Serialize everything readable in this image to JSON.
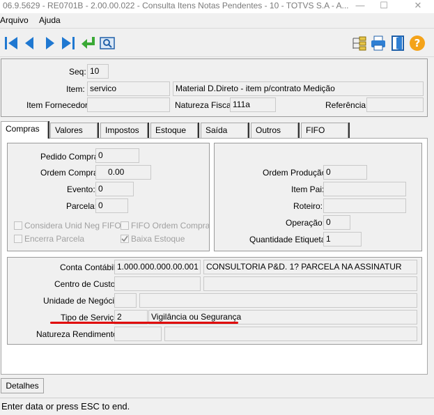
{
  "window": {
    "title": "06.9.5629 - RE0701B - 2.00.00.022 - Consulta Itens Notas Pendentes - 10 - TOTVS S.A - A...",
    "minimize_glyph": "—",
    "maximize_glyph": "☐",
    "close_glyph": "✕"
  },
  "menu": {
    "items": [
      "Arquivo",
      "Ajuda"
    ]
  },
  "toolbar": {
    "left_icons": [
      "first-record-icon",
      "previous-record-icon",
      "next-record-icon",
      "last-record-icon",
      "return-icon",
      "search-icon"
    ],
    "right_icons": [
      "tree-icon",
      "print-icon",
      "exit-icon",
      "help-icon"
    ],
    "colors": {
      "nav_blue": "#1f78d1",
      "return_green": "#3aa935",
      "help_orange": "#f4a31a"
    }
  },
  "header": {
    "seq_label": "Seq:",
    "seq_value": "10",
    "item_label": "Item:",
    "item_value": "servico",
    "item_desc": "Material D.Direto - item p/contrato Medição",
    "item_fornecedor_label": "Item Fornecedor:",
    "item_fornecedor_value": "",
    "natureza_fiscal_label": "Natureza Fiscal",
    "natureza_fiscal_value": "111a",
    "referencia_label": "Referência:",
    "referencia_value": ""
  },
  "tabs": [
    {
      "label": "Compras",
      "active": true
    },
    {
      "label": "Valores",
      "active": false
    },
    {
      "label": "Impostos",
      "active": false
    },
    {
      "label": "Estoque",
      "active": false
    },
    {
      "label": "Saída",
      "active": false
    },
    {
      "label": "Outros",
      "active": false
    },
    {
      "label": "FIFO",
      "active": false
    }
  ],
  "compras": {
    "pedido_compra_label": "Pedido Compra:",
    "pedido_compra_value": "0",
    "ordem_compra_label": "Ordem Compra:",
    "ordem_compra_value": "0.00",
    "evento_label": "Evento:",
    "evento_value": "0",
    "parcela_label": "Parcela:",
    "parcela_value": "0",
    "considera_unid_label": "Considera Unid Neg FIFO",
    "fifo_ordem_label": "FIFO Ordem Compra",
    "encerra_parcela_label": "Encerra Parcela",
    "baixa_estoque_label": "Baixa Estoque",
    "baixa_estoque_checked": true
  },
  "producao": {
    "ordem_producao_label": "Ordem Produção:",
    "ordem_producao_value": "0",
    "item_pai_label": "Item Pai:",
    "item_pai_value": "",
    "roteiro_label": "Roteiro:",
    "roteiro_value": "",
    "operacao_label": "Operação:",
    "operacao_value": "0",
    "qtd_etiqueta_label": "Quantidade Etiqueta:",
    "qtd_etiqueta_value": "1"
  },
  "contabil": {
    "conta_contabil_label": "Conta Contábil:",
    "conta_contabil_value": "1.000.000.000.00.001",
    "conta_contabil_desc": "CONSULTORIA P&D. 1? PARCELA NA ASSINATUR",
    "centro_custo_label": "Centro de Custo:",
    "centro_custo_value": "",
    "centro_custo_desc": "",
    "unidade_negocio_label": "Unidade de Negócio:",
    "unidade_negocio_value": "",
    "unidade_negocio_desc": "",
    "tipo_servico_label": "Tipo de Serviço:",
    "tipo_servico_value": "2",
    "tipo_servico_desc": "Vigilância ou Segurança",
    "natureza_rendimento_label": "Natureza Rendimento:",
    "natureza_rendimento_value": "",
    "natureza_rendimento_desc": "",
    "highlight_color": "#e00000"
  },
  "footer": {
    "detalhes_label": "Detalhes"
  },
  "status": {
    "text": "Enter data or press ESC to end."
  }
}
